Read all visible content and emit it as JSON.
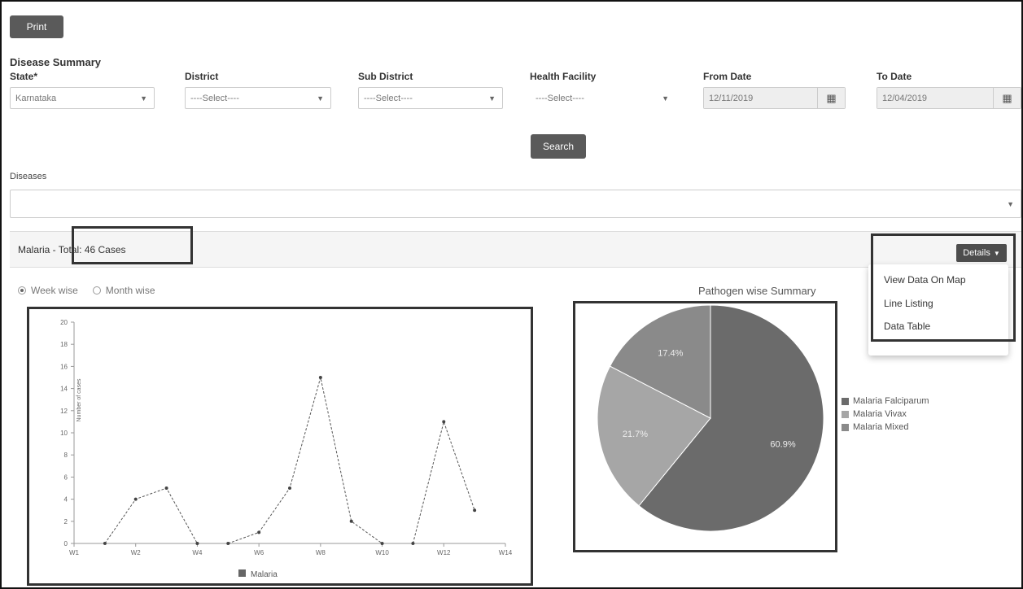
{
  "toolbar": {
    "print_label": "Print"
  },
  "page": {
    "title": "Disease Summary"
  },
  "filters": {
    "state": {
      "label": "State*",
      "value": "Karnataka"
    },
    "district": {
      "label": "District",
      "value": "----Select----"
    },
    "sub_district": {
      "label": "Sub District",
      "value": "----Select----"
    },
    "health_facility": {
      "label": "Health Facility",
      "value": "----Select----"
    },
    "from_date": {
      "label": "From Date",
      "value": "12/11/2019"
    },
    "to_date": {
      "label": "To Date",
      "value": "12/04/2019"
    }
  },
  "search_label": "Search",
  "disease": {
    "label": "Diseases",
    "value": ""
  },
  "panel": {
    "title": "Malaria - Total: 46 Cases"
  },
  "details": {
    "button_label": "Details",
    "menu": [
      "View Data On Map",
      "Line Listing",
      "Data Table"
    ]
  },
  "view_toggle": {
    "options": [
      "Week wise",
      "Month wise"
    ],
    "selected": "Week wise"
  },
  "icons": {
    "calendar": "calendar-icon",
    "caret": "caret-down-icon",
    "radio": "radio-icon"
  },
  "colors": {
    "button": "#5a5a5a",
    "pie_falciparum": "#6b6b6b",
    "pie_vivax": "#a6a6a6",
    "pie_mixed": "#8a8a8a",
    "line": "#555555"
  },
  "chart_data": [
    {
      "type": "line",
      "title": "",
      "xlabel": "",
      "ylabel": "Number of cases",
      "y_ticks": [
        0,
        2,
        4,
        6,
        8,
        10,
        12,
        14,
        16,
        18,
        20
      ],
      "ylim": [
        0,
        20
      ],
      "x_ticks": [
        "W1",
        "W2",
        "W4",
        "W6",
        "W8",
        "W10",
        "W12",
        "W14"
      ],
      "series": [
        {
          "name": "Malaria",
          "segments": [
            [
              [
                1,
                0
              ],
              [
                2,
                4
              ],
              [
                3,
                5
              ],
              [
                4,
                0
              ]
            ],
            [
              [
                5,
                0
              ],
              [
                6,
                1
              ],
              [
                7,
                5
              ],
              [
                8,
                15
              ],
              [
                9,
                2
              ],
              [
                10,
                0
              ]
            ],
            [
              [
                11,
                0
              ],
              [
                12,
                11
              ],
              [
                13,
                3
              ]
            ]
          ]
        }
      ],
      "legend": "bottom"
    },
    {
      "type": "pie",
      "title": "Pathogen wise Summary",
      "slices": [
        {
          "label": "Malaria Falciparum",
          "value": 60.9,
          "display": "60.9%"
        },
        {
          "label": "Malaria Vivax",
          "value": 21.7,
          "display": "21.7%"
        },
        {
          "label": "Malaria Mixed",
          "value": 17.4,
          "display": "17.4%"
        }
      ],
      "legend": "right"
    }
  ]
}
